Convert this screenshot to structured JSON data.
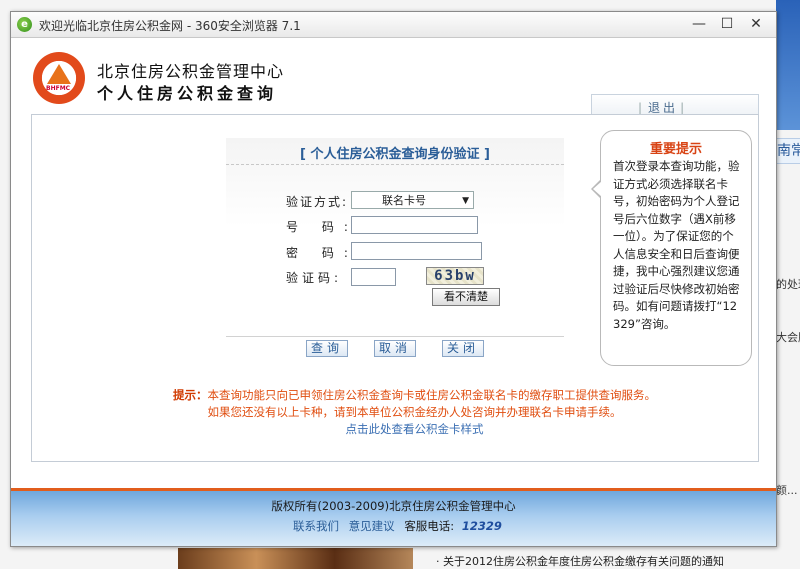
{
  "browser": {
    "title": "欢迎光临北京住房公积金网 - 360安全浏览器 7.1",
    "min_glyph": "—",
    "max_glyph": "☐",
    "close_glyph": "✕"
  },
  "background": {
    "tab_text": "南常",
    "side_snippets": [
      "的处理",
      "大会股",
      "颜..."
    ],
    "news_item": "· 关于2012住房公积金年度住房公积金缴存有关问题的通知"
  },
  "header": {
    "org_name": "北京住房公积金管理中心",
    "system_name": "个人住房公积金查询",
    "logo_text": "BHFMC",
    "logout_label": "退出"
  },
  "form": {
    "title": "[ 个人住房公积金查询身份验证 ]",
    "method_label": "验证方式:",
    "method_value": "联名卡号",
    "number_label": "号  码:",
    "password_label": "密  码:",
    "captcha_label": "验证码:",
    "captcha_text": "63bw",
    "refresh_label": "看不清楚",
    "query_button": "查询",
    "cancel_button": "取消",
    "close_button": "关闭"
  },
  "tip": {
    "title": "重要提示",
    "body": "首次登录本查询功能，验证方式必须选择联名卡号，初始密码为个人登记号后六位数字（遇X前移一位）。为了保证您的个人信息安全和日后查询便捷，我中心强烈建议您通过验证后尽快修改初始密码。如有问题请拨打“12329”咨询。"
  },
  "notice": {
    "prefix": "提示：",
    "line1": "本查询功能只向已申领住房公积金查询卡或住房公积金联名卡的缴存职工提供查询服务。",
    "line2": "如果您还没有以上卡种，请到本单位公积金经办人处咨询并办理联名卡申请手续。",
    "link": "点击此处查看公积金卡样式"
  },
  "footer": {
    "copyright": "版权所有(2003-2009)北京住房公积金管理中心",
    "contact_link": "联系我们",
    "feedback_link": "意见建议",
    "hotline_label": "客服电话:",
    "hotline_number": "12329"
  },
  "colors": {
    "accent_orange": "#e15d1c",
    "link_blue": "#2b5e98",
    "footer_blue": "#6fa7dd"
  }
}
